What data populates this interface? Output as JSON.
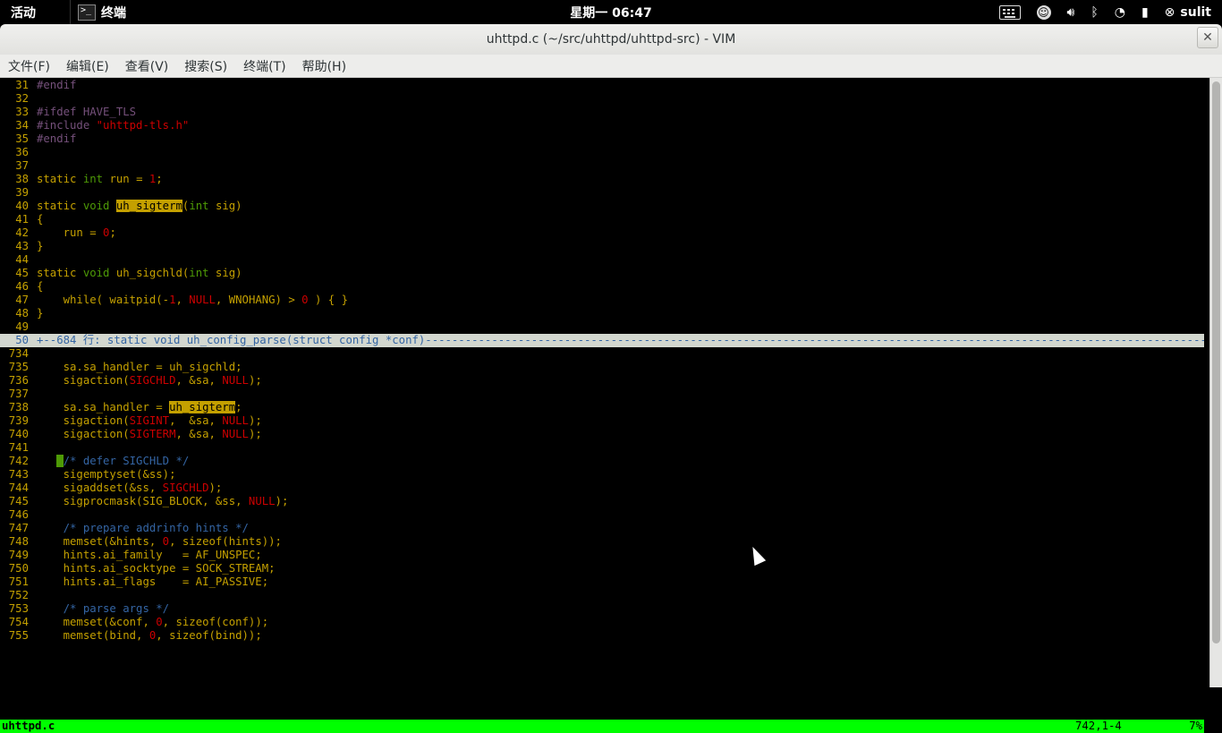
{
  "topbar": {
    "activities": "活动",
    "app_name": "终端",
    "clock": "星期一 06:47",
    "user": "sulit"
  },
  "window": {
    "title": "uhttpd.c (~/src/uhttpd/uhttpd-src) - VIM",
    "close": "✕"
  },
  "menu": [
    "文件(F)",
    "编辑(E)",
    "查看(V)",
    "搜索(S)",
    "终端(T)",
    "帮助(H)"
  ],
  "editor": {
    "lines": [
      {
        "n": "31",
        "s": [
          [
            "#endif",
            "pre"
          ]
        ]
      },
      {
        "n": "32",
        "s": []
      },
      {
        "n": "33",
        "s": [
          [
            "#ifdef HAVE_TLS",
            "pre"
          ]
        ]
      },
      {
        "n": "34",
        "s": [
          [
            "#include ",
            "pre"
          ],
          [
            "\"uhttpd-tls.h\"",
            "str"
          ]
        ]
      },
      {
        "n": "35",
        "s": [
          [
            "#endif",
            "pre"
          ]
        ]
      },
      {
        "n": "36",
        "s": []
      },
      {
        "n": "37",
        "s": []
      },
      {
        "n": "38",
        "s": [
          [
            "static ",
            "kw"
          ],
          [
            "int ",
            "ty"
          ],
          [
            "run = ",
            "id"
          ],
          [
            "1",
            "num"
          ],
          [
            ";",
            "id"
          ]
        ]
      },
      {
        "n": "39",
        "s": []
      },
      {
        "n": "40",
        "s": [
          [
            "static ",
            "kw"
          ],
          [
            "void ",
            "ty"
          ],
          [
            "uh_sigterm",
            "hl"
          ],
          [
            "(",
            "id"
          ],
          [
            "int ",
            "ty"
          ],
          [
            "sig)",
            "id"
          ]
        ]
      },
      {
        "n": "41",
        "s": [
          [
            "{",
            "id"
          ]
        ]
      },
      {
        "n": "42",
        "s": [
          [
            "    run = ",
            "id"
          ],
          [
            "0",
            "num"
          ],
          [
            ";",
            "id"
          ]
        ]
      },
      {
        "n": "43",
        "s": [
          [
            "}",
            "id"
          ]
        ]
      },
      {
        "n": "44",
        "s": []
      },
      {
        "n": "45",
        "s": [
          [
            "static ",
            "kw"
          ],
          [
            "void ",
            "ty"
          ],
          [
            "uh_sigchld(",
            "id"
          ],
          [
            "int ",
            "ty"
          ],
          [
            "sig)",
            "id"
          ]
        ]
      },
      {
        "n": "46",
        "s": [
          [
            "{",
            "id"
          ]
        ]
      },
      {
        "n": "47",
        "s": [
          [
            "    while( waitpid(-",
            "id"
          ],
          [
            "1",
            "num"
          ],
          [
            ", ",
            "id"
          ],
          [
            "NULL",
            "str"
          ],
          [
            ", WNOHANG) > ",
            "id"
          ],
          [
            "0",
            "num"
          ],
          [
            " ) { }",
            "id"
          ]
        ]
      },
      {
        "n": "48",
        "s": [
          [
            "}",
            "id"
          ]
        ]
      },
      {
        "n": "49",
        "s": []
      },
      {
        "n": "50",
        "fold": true,
        "s": [
          [
            "+--684 行: static void uh_config_parse(struct config *conf)---------------------------------------------------------------------------------------------------------------------------------------------",
            "cm"
          ]
        ]
      },
      {
        "n": "734",
        "s": []
      },
      {
        "n": "735",
        "s": [
          [
            "    sa.sa_handler = uh_sigchld;",
            "id"
          ]
        ]
      },
      {
        "n": "736",
        "s": [
          [
            "    sigaction(",
            "id"
          ],
          [
            "SIGCHLD",
            "str"
          ],
          [
            ", &sa, ",
            "id"
          ],
          [
            "NULL",
            "str"
          ],
          [
            ");",
            "id"
          ]
        ]
      },
      {
        "n": "737",
        "s": []
      },
      {
        "n": "738",
        "s": [
          [
            "    sa.sa_handler = ",
            "id"
          ],
          [
            "uh_sigterm",
            "hl"
          ],
          [
            ";",
            "id"
          ]
        ]
      },
      {
        "n": "739",
        "s": [
          [
            "    sigaction(",
            "id"
          ],
          [
            "SIGINT",
            "str"
          ],
          [
            ",  &sa, ",
            "id"
          ],
          [
            "NULL",
            "str"
          ],
          [
            ");",
            "id"
          ]
        ]
      },
      {
        "n": "740",
        "s": [
          [
            "    sigaction(",
            "id"
          ],
          [
            "SIGTERM",
            "str"
          ],
          [
            ", &sa, ",
            "id"
          ],
          [
            "NULL",
            "str"
          ],
          [
            ");",
            "id"
          ]
        ]
      },
      {
        "n": "741",
        "s": []
      },
      {
        "n": "742",
        "s": [
          [
            "   ",
            "id"
          ],
          [
            " ",
            "cursor"
          ],
          [
            "/* defer SIGCHLD */",
            "cm"
          ]
        ]
      },
      {
        "n": "743",
        "s": [
          [
            "    sigemptyset(&ss);",
            "id"
          ]
        ]
      },
      {
        "n": "744",
        "s": [
          [
            "    sigaddset(&ss, ",
            "id"
          ],
          [
            "SIGCHLD",
            "str"
          ],
          [
            ");",
            "id"
          ]
        ]
      },
      {
        "n": "745",
        "s": [
          [
            "    sigprocmask(SIG_BLOCK, &ss, ",
            "id"
          ],
          [
            "NULL",
            "str"
          ],
          [
            ");",
            "id"
          ]
        ]
      },
      {
        "n": "746",
        "s": []
      },
      {
        "n": "747",
        "s": [
          [
            "    /* prepare addrinfo hints */",
            "cm"
          ]
        ]
      },
      {
        "n": "748",
        "s": [
          [
            "    memset(&hints, ",
            "id"
          ],
          [
            "0",
            "num"
          ],
          [
            ", sizeof(hints));",
            "id"
          ]
        ]
      },
      {
        "n": "749",
        "s": [
          [
            "    hints.ai_family   = AF_UNSPEC;",
            "id"
          ]
        ]
      },
      {
        "n": "750",
        "s": [
          [
            "    hints.ai_socktype = SOCK_STREAM;",
            "id"
          ]
        ]
      },
      {
        "n": "751",
        "s": [
          [
            "    hints.ai_flags    = AI_PASSIVE;",
            "id"
          ]
        ]
      },
      {
        "n": "752",
        "s": []
      },
      {
        "n": "753",
        "s": [
          [
            "    /* parse args */",
            "cm"
          ]
        ]
      },
      {
        "n": "754",
        "s": [
          [
            "    memset(&conf, ",
            "id"
          ],
          [
            "0",
            "num"
          ],
          [
            ", sizeof(conf));",
            "id"
          ]
        ]
      },
      {
        "n": "755",
        "s": [
          [
            "    memset(bind, ",
            "id"
          ],
          [
            "0",
            "num"
          ],
          [
            ", sizeof(bind));",
            "id"
          ]
        ]
      }
    ]
  },
  "status": {
    "filename": "uhttpd.c",
    "position": "742,1-4",
    "percent": "7%"
  }
}
